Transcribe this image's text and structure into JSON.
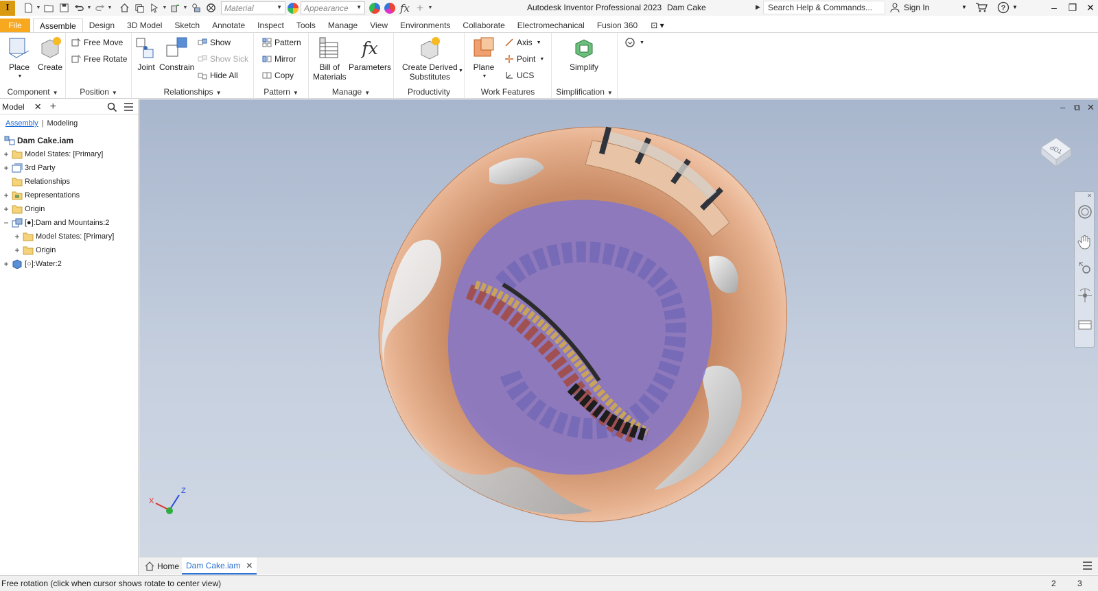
{
  "titlebar": {
    "material_placeholder": "Material",
    "appearance_placeholder": "Appearance",
    "app_title": "Autodesk Inventor Professional 2023",
    "document_title": "Dam Cake",
    "search_placeholder": "Search Help & Commands...",
    "sign_in": "Sign In",
    "app_letter": "I"
  },
  "tabs": [
    "File",
    "Assemble",
    "Design",
    "3D Model",
    "Sketch",
    "Annotate",
    "Inspect",
    "Tools",
    "Manage",
    "View",
    "Environments",
    "Collaborate",
    "Electromechanical",
    "Fusion 360"
  ],
  "active_tab": "Assemble",
  "ribbon": {
    "component": {
      "title": "Component",
      "place": "Place",
      "create": "Create"
    },
    "position": {
      "title": "Position",
      "free_move": "Free Move",
      "free_rotate": "Free Rotate"
    },
    "relationships": {
      "title": "Relationships",
      "joint": "Joint",
      "constrain": "Constrain",
      "show": "Show",
      "show_sick": "Show Sick",
      "hide_all": "Hide All"
    },
    "pattern": {
      "title": "Pattern",
      "pattern": "Pattern",
      "mirror": "Mirror",
      "copy": "Copy"
    },
    "manage": {
      "title": "Manage",
      "bom_line1": "Bill of",
      "bom_line2": "Materials",
      "parameters": "Parameters"
    },
    "productivity": {
      "title": "Productivity",
      "cds_line1": "Create Derived",
      "cds_line2": "Substitutes"
    },
    "work_features": {
      "title": "Work Features",
      "plane": "Plane",
      "axis": "Axis",
      "point": "Point",
      "ucs": "UCS"
    },
    "simplification": {
      "title": "Simplification",
      "simplify": "Simplify"
    }
  },
  "browser": {
    "tab_label": "Model",
    "subtab_assembly": "Assembly",
    "subtab_modeling": "Modeling",
    "nodes": [
      {
        "label": "Dam Cake.iam",
        "icon": "assembly-icon"
      },
      {
        "label": "Model States: [Primary]",
        "icon": "folder-icon"
      },
      {
        "label": "3rd Party",
        "icon": "third-party-icon"
      },
      {
        "label": "Relationships",
        "icon": "folder-icon"
      },
      {
        "label": "Representations",
        "icon": "representations-icon"
      },
      {
        "label": "Origin",
        "icon": "folder-icon"
      },
      {
        "label": "[●]:Dam and Mountains:2",
        "icon": "subassembly-icon"
      },
      {
        "label": "Model States: [Primary]",
        "icon": "folder-icon"
      },
      {
        "label": "Origin",
        "icon": "folder-icon"
      },
      {
        "label": "[○]:Water:2",
        "icon": "part-icon"
      }
    ]
  },
  "viewcube_label": "TOP",
  "triad": {
    "x": "X",
    "z": "Z"
  },
  "doc_tabs": {
    "home": "Home",
    "active_doc": "Dam Cake.iam"
  },
  "status": {
    "message": "Free rotation (click when cursor shows rotate to center view)",
    "count_a": "2",
    "count_b": "3"
  },
  "colors": {
    "file_tab": "#f8a81f",
    "app_logo": "#d99a11",
    "accent": "#2a6fd1",
    "viewport_top": "#a8b6cd",
    "viewport_bottom": "#d0d8e4"
  }
}
